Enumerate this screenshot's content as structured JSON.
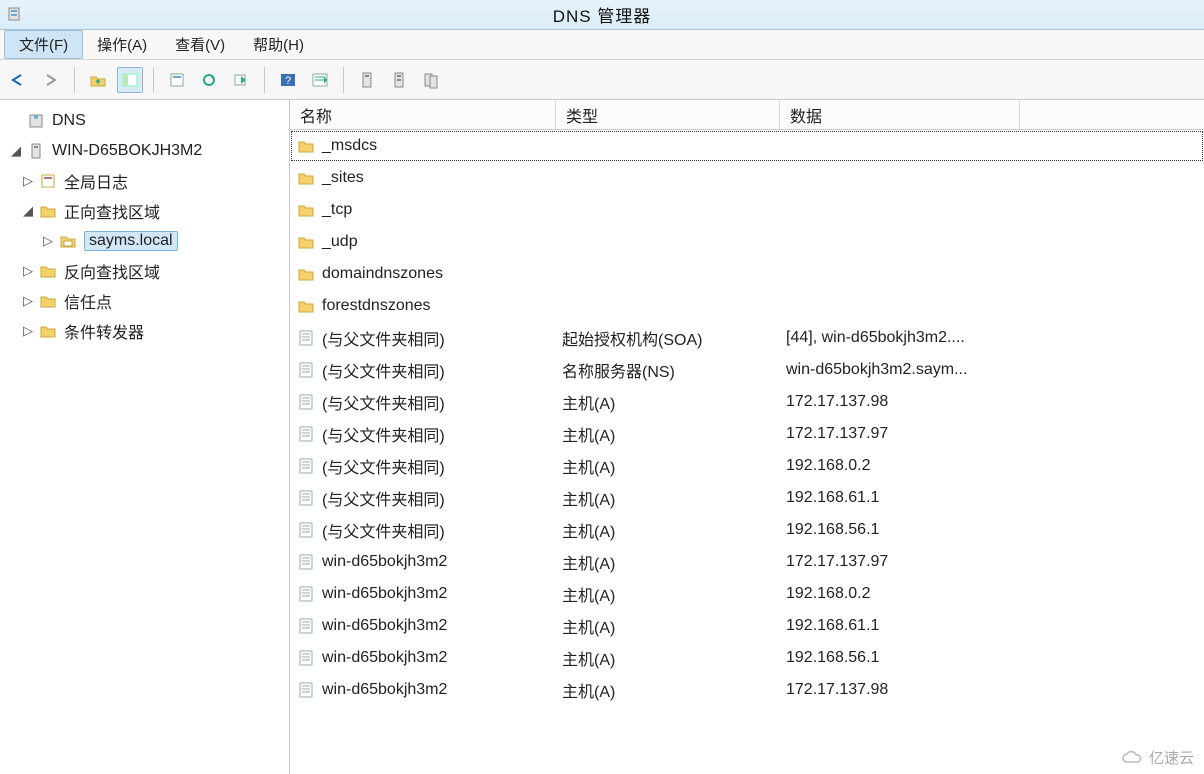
{
  "window": {
    "title": "DNS 管理器"
  },
  "menu": {
    "file": "文件(F)",
    "action": "操作(A)",
    "view": "查看(V)",
    "help": "帮助(H)"
  },
  "tree": {
    "root": "DNS",
    "server": "WIN-D65BOKJH3M2",
    "globalLog": "全局日志",
    "fwdZones": "正向查找区域",
    "zoneSel": "sayms.local",
    "revZones": "反向查找区域",
    "trustPoints": "信任点",
    "condFwd": "条件转发器"
  },
  "columns": {
    "name": "名称",
    "type": "类型",
    "data": "数据"
  },
  "rows": [
    {
      "icon": "folder",
      "name": "_msdcs",
      "type": "",
      "data": "",
      "focused": true
    },
    {
      "icon": "folder",
      "name": "_sites",
      "type": "",
      "data": ""
    },
    {
      "icon": "folder",
      "name": "_tcp",
      "type": "",
      "data": ""
    },
    {
      "icon": "folder",
      "name": "_udp",
      "type": "",
      "data": ""
    },
    {
      "icon": "folder",
      "name": "domaindnszones",
      "type": "",
      "data": ""
    },
    {
      "icon": "folder",
      "name": "forestdnszones",
      "type": "",
      "data": ""
    },
    {
      "icon": "record",
      "name": "(与父文件夹相同)",
      "type": "起始授权机构(SOA)",
      "data": "[44], win-d65bokjh3m2...."
    },
    {
      "icon": "record",
      "name": "(与父文件夹相同)",
      "type": "名称服务器(NS)",
      "data": "win-d65bokjh3m2.saym..."
    },
    {
      "icon": "record",
      "name": "(与父文件夹相同)",
      "type": "主机(A)",
      "data": "172.17.137.98"
    },
    {
      "icon": "record",
      "name": "(与父文件夹相同)",
      "type": "主机(A)",
      "data": "172.17.137.97"
    },
    {
      "icon": "record",
      "name": "(与父文件夹相同)",
      "type": "主机(A)",
      "data": "192.168.0.2"
    },
    {
      "icon": "record",
      "name": "(与父文件夹相同)",
      "type": "主机(A)",
      "data": "192.168.61.1"
    },
    {
      "icon": "record",
      "name": "(与父文件夹相同)",
      "type": "主机(A)",
      "data": "192.168.56.1"
    },
    {
      "icon": "record",
      "name": "win-d65bokjh3m2",
      "type": "主机(A)",
      "data": "172.17.137.97"
    },
    {
      "icon": "record",
      "name": "win-d65bokjh3m2",
      "type": "主机(A)",
      "data": "192.168.0.2"
    },
    {
      "icon": "record",
      "name": "win-d65bokjh3m2",
      "type": "主机(A)",
      "data": "192.168.61.1"
    },
    {
      "icon": "record",
      "name": "win-d65bokjh3m2",
      "type": "主机(A)",
      "data": "192.168.56.1"
    },
    {
      "icon": "record",
      "name": "win-d65bokjh3m2",
      "type": "主机(A)",
      "data": "172.17.137.98"
    }
  ],
  "watermark": "亿速云"
}
